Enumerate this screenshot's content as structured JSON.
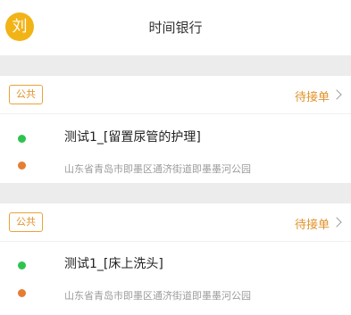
{
  "header": {
    "avatar_text": "刘",
    "title": "时间银行"
  },
  "orders": [
    {
      "tag": "公共",
      "status": "待接单",
      "title": "测试1_[留置尿管的护理]",
      "address": "山东省青岛市即墨区通济街道即墨墨河公园"
    },
    {
      "tag": "公共",
      "status": "待接单",
      "title": "测试1_[床上洗头]",
      "address": "山东省青岛市即墨区通济街道即墨墨河公园"
    }
  ],
  "colors": {
    "accent": "#e0922b",
    "avatar": "#f2b317",
    "start_dot": "#2ec34f",
    "end_dot": "#e67d32"
  }
}
